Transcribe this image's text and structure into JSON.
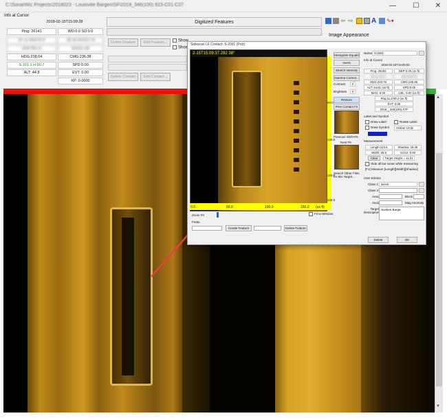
{
  "window": {
    "title": "C:\\SonarWiz Projects\\2018023 - Louisville Barges\\SF\\2018_346(100) 923-C01-C07",
    "btn_min": "—",
    "btn_max": "☐",
    "btn_close": "✕"
  },
  "info": {
    "header": "Info at Cursor",
    "datetime": "2018-02-15T15:09:28",
    "ping": "Ping: 26141",
    "wd": "WD:0.0 SD:0.0",
    "lat": "36 12.345678 N",
    "lon": "-85 45.654321 W",
    "northing": "3456789.12",
    "easting": "654321.98",
    "hdg": "HDG:238.04",
    "cmg": "CMG:236.38",
    "svalues": "S:101.1 H:90.7",
    "spd": "SPD:0.00",
    "alt": "ALT: 44.8",
    "evt": "EVT: 0.00",
    "kp": "KP: 0.0000"
  },
  "features": {
    "header": "Digitized Features",
    "btn_delete_feature": "Delete Feature",
    "btn_edit_feature": "Edit Feature...",
    "btn_delete_contact": "Delete Contact",
    "btn_edit_contact": "Edit Contact...",
    "chk1": "Show",
    "chk2": "Show"
  },
  "appearance": {
    "header": "Image Appearance"
  },
  "channel": {
    "port": "Port"
  },
  "dialog": {
    "title": "Sidescan LF Contact: S-2001 (Port)",
    "sonar_time": "2-15T15:09:37.292 38°",
    "x_ticks": [
      "0.0",
      "50.0",
      "100.0",
      "150.0",
      "(us ft)"
    ],
    "y_ticks": [
      "50.0",
      "100.0",
      "150.0",
      "200.0"
    ],
    "fit_window": "Fit to Window",
    "zoom_fit": "Zoom Fit",
    "feat_label": "Featu",
    "btn_create_feature": "Create Feature",
    "btn_delete_feature": "Delete Feature",
    "tools": {
      "histogram": "Histogram Equaliz",
      "invert": "Invert",
      "stretch": "Stretch Intensity",
      "gamma": "Gamma Correct...",
      "contrast_label": "Contrast",
      "contrast_val": "0",
      "brightness_label": "Brightnes",
      "brightness_val": "0",
      "restore": "Restore",
      "prev_contact": "Prev Contact F2",
      "prev_shift": "Previous Shift+F8",
      "next": "Next F8",
      "search_other": "Search Other Files for this Target..."
    },
    "form": {
      "name_label": "Name",
      "name_val": "S-2001",
      "info_header": "Info at Cursor",
      "datetime": "2018-02-15T15:09:02",
      "ping": "Ping: 26192",
      "dep": "DEP:0.00 (us ft)",
      "lat": "36 12.34 N",
      "lon": "-85 45.65 W",
      "hdg": "HDG:233.78",
      "cmg": "CMG:236.96",
      "alt": "ALT: 44.81 (us ft)",
      "spd": "SPD:0.00",
      "mag": "MAG: 0.00",
      "cbl": "CBL: 0.00 (us ft)",
      "rng": "Rng:11.2/48.2 (us ft)",
      "evt": "EVT: 0.00",
      "file": "2018__346(100).XTF",
      "label_symbol": "Label and Symbol",
      "draw_label": "Draw Label",
      "rotate_label": "Rotate Label",
      "draw_symbol": "Draw Symbol",
      "symbol_sel": "Hollow Circle",
      "measurement": "Measurement",
      "length": "Length:124.6",
      "shadow": "Shadow: 15.45",
      "width": "Width: 26.9",
      "scour": "Scour: 0.00",
      "clear": "Clear",
      "target_height": "Target Height = 11.01",
      "hide_all": "Hide all but sonar while measuring",
      "hint": "[F1] Measure [Length][Width][Shadow]",
      "user_entries": "User Entries",
      "class1_label": "Class 1",
      "class1_val": "wreck",
      "class2_label": "Class 2",
      "area_label": "Area",
      "block_label": "Block",
      "avoid_label": "Avoid",
      "mag_label": "Mag Anomaly",
      "desc_label": "Target Description",
      "desc_val": "Sunken Barge",
      "delete": "Delete",
      "ok": "OK"
    }
  },
  "colors": {
    "port": "#e8140c",
    "sonar": "#e0a020",
    "yellow": "#ffff00",
    "green": "#2eb82e",
    "arrow": "#e84040"
  }
}
